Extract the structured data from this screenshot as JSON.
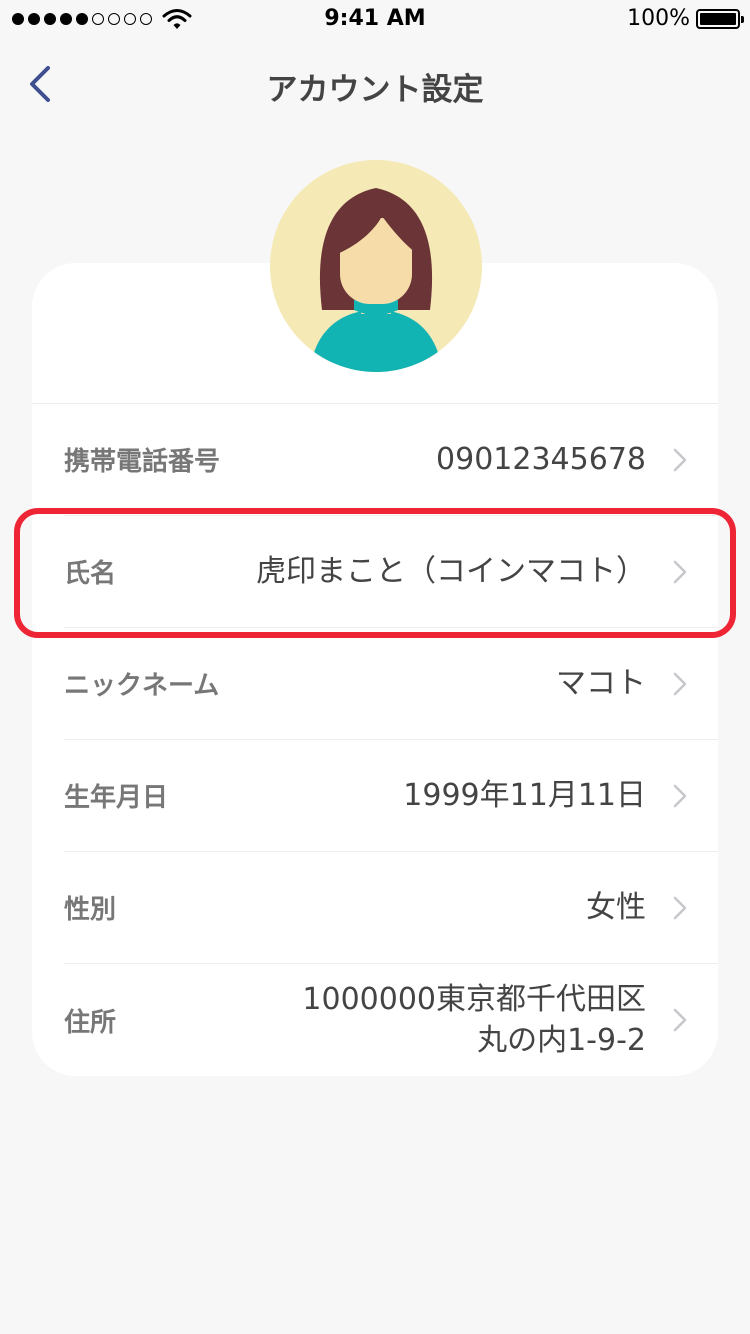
{
  "status_bar": {
    "time": "9:41 AM",
    "battery_percent": "100%",
    "signal_dots_filled": 5,
    "signal_dots_total": 9,
    "battery_level": 1.0
  },
  "header": {
    "title": "アカウント設定",
    "back_icon": "chevron-left-icon"
  },
  "profile": {
    "avatar_icon": "female-avatar-icon"
  },
  "rows": [
    {
      "label": "携帯電話番号",
      "value": [
        "09012345678"
      ]
    },
    {
      "label": "氏名",
      "value": [
        "虎印まこと（コインマコト）"
      ]
    },
    {
      "label": "ニックネーム",
      "value": [
        "マコト"
      ]
    },
    {
      "label": "生年月日",
      "value": [
        "1999年11月11日"
      ]
    },
    {
      "label": "性別",
      "value": [
        "女性"
      ]
    },
    {
      "label": "住所",
      "value": [
        "1000000東京都千代田区",
        "丸の内1-9-2"
      ]
    }
  ],
  "colors": {
    "background": "#f7f7f7",
    "card": "#ffffff",
    "accent_back": "#3f4f8f",
    "highlight_border": "#ee2535",
    "avatar_bg": "#f5e9b6",
    "hair": "#6b3436",
    "shirt": "#12b3b3"
  }
}
